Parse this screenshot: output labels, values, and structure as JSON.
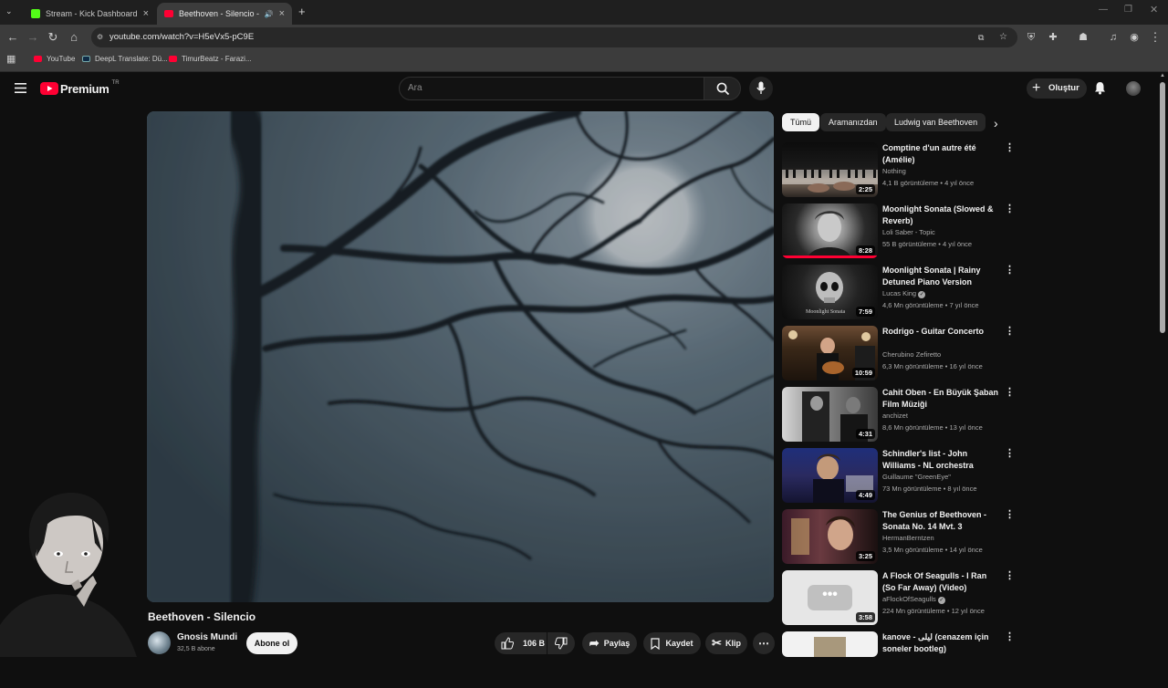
{
  "browser": {
    "tabs": [
      {
        "title": "Stream - Kick Dashboard",
        "close": "×"
      },
      {
        "title": "Beethoven - Silencio - YouT",
        "close": "×"
      }
    ],
    "new_tab": "+",
    "url": "youtube.com/watch?v=H5eVx5-pC9E",
    "bookmarks": [
      {
        "label": "YouTube"
      },
      {
        "label": "DeepL Translate: Dü..."
      },
      {
        "label": "TimurBeatz - Farazi..."
      }
    ]
  },
  "youtube": {
    "logo_text": "Premium",
    "logo_region": "TR",
    "search_placeholder": "Ara",
    "create_label": "Oluştur",
    "chips": [
      "Tümü",
      "Aramanızdan",
      "Ludwig van Beethoven"
    ],
    "video": {
      "title": "Beethoven - Silencio",
      "channel": "Gnosis Mundi",
      "subscribers": "32,5 B abone",
      "subscribe_label": "Abone ol",
      "likes": "106 B",
      "share_label": "Paylaş",
      "save_label": "Kaydet",
      "clip_label": "Klip"
    },
    "recommendations": [
      {
        "title": "Comptine d'un autre été (Amélie)",
        "channel": "Nothing",
        "meta": "4,1 B görüntüleme • 4 yıl önce",
        "duration": "2:25",
        "verified": false
      },
      {
        "title": "Moonlight Sonata (Slowed & Reverb)",
        "channel": "Loli Saber - Topic",
        "meta": "55 B görüntüleme • 4 yıl önce",
        "duration": "8:28",
        "verified": false
      },
      {
        "title": "Moonlight Sonata | Rainy Detuned Piano Version",
        "channel": "Lucas King",
        "meta": "4,6 Mn görüntüleme • 7 yıl önce",
        "duration": "7:59",
        "verified": true,
        "thumb_text": "Moonlight Sonata"
      },
      {
        "title": "Rodrigo - Guitar Concerto",
        "channel": "Cherubino Zefiretto",
        "meta": "6,3 Mn görüntüleme • 16 yıl önce",
        "duration": "10:59",
        "verified": false
      },
      {
        "title": "Cahit Oben - En Büyük Şaban Film Müziği",
        "channel": "anchizet",
        "meta": "8,6 Mn görüntüleme • 13 yıl önce",
        "duration": "4:31",
        "verified": false
      },
      {
        "title": "Schindler's list - John Williams - NL orchestra",
        "channel": "Guillaume \"GreenEye\"",
        "meta": "73 Mn görüntüleme • 8 yıl önce",
        "duration": "4:49",
        "verified": false
      },
      {
        "title": "The Genius of Beethoven - Sonata No. 14 Mvt. 3",
        "channel": "HermanBerntzen",
        "meta": "3,5 Mn görüntüleme • 14 yıl önce",
        "duration": "3:25",
        "verified": false
      },
      {
        "title": "A Flock Of Seagulls - I Ran (So Far Away) (Video)",
        "channel": "aFlockOfSeagulls",
        "meta": "224 Mn görüntüleme • 12 yıl önce",
        "duration": "3:58",
        "verified": true
      },
      {
        "title": "kanove - ليلى (cenazem için soneler bootleg)",
        "channel": "",
        "meta": "",
        "duration": "",
        "verified": false
      }
    ]
  },
  "colors": {
    "brand_red": "#ff0033",
    "kick_green": "#53fc18",
    "bg": "#0f0f0f"
  }
}
